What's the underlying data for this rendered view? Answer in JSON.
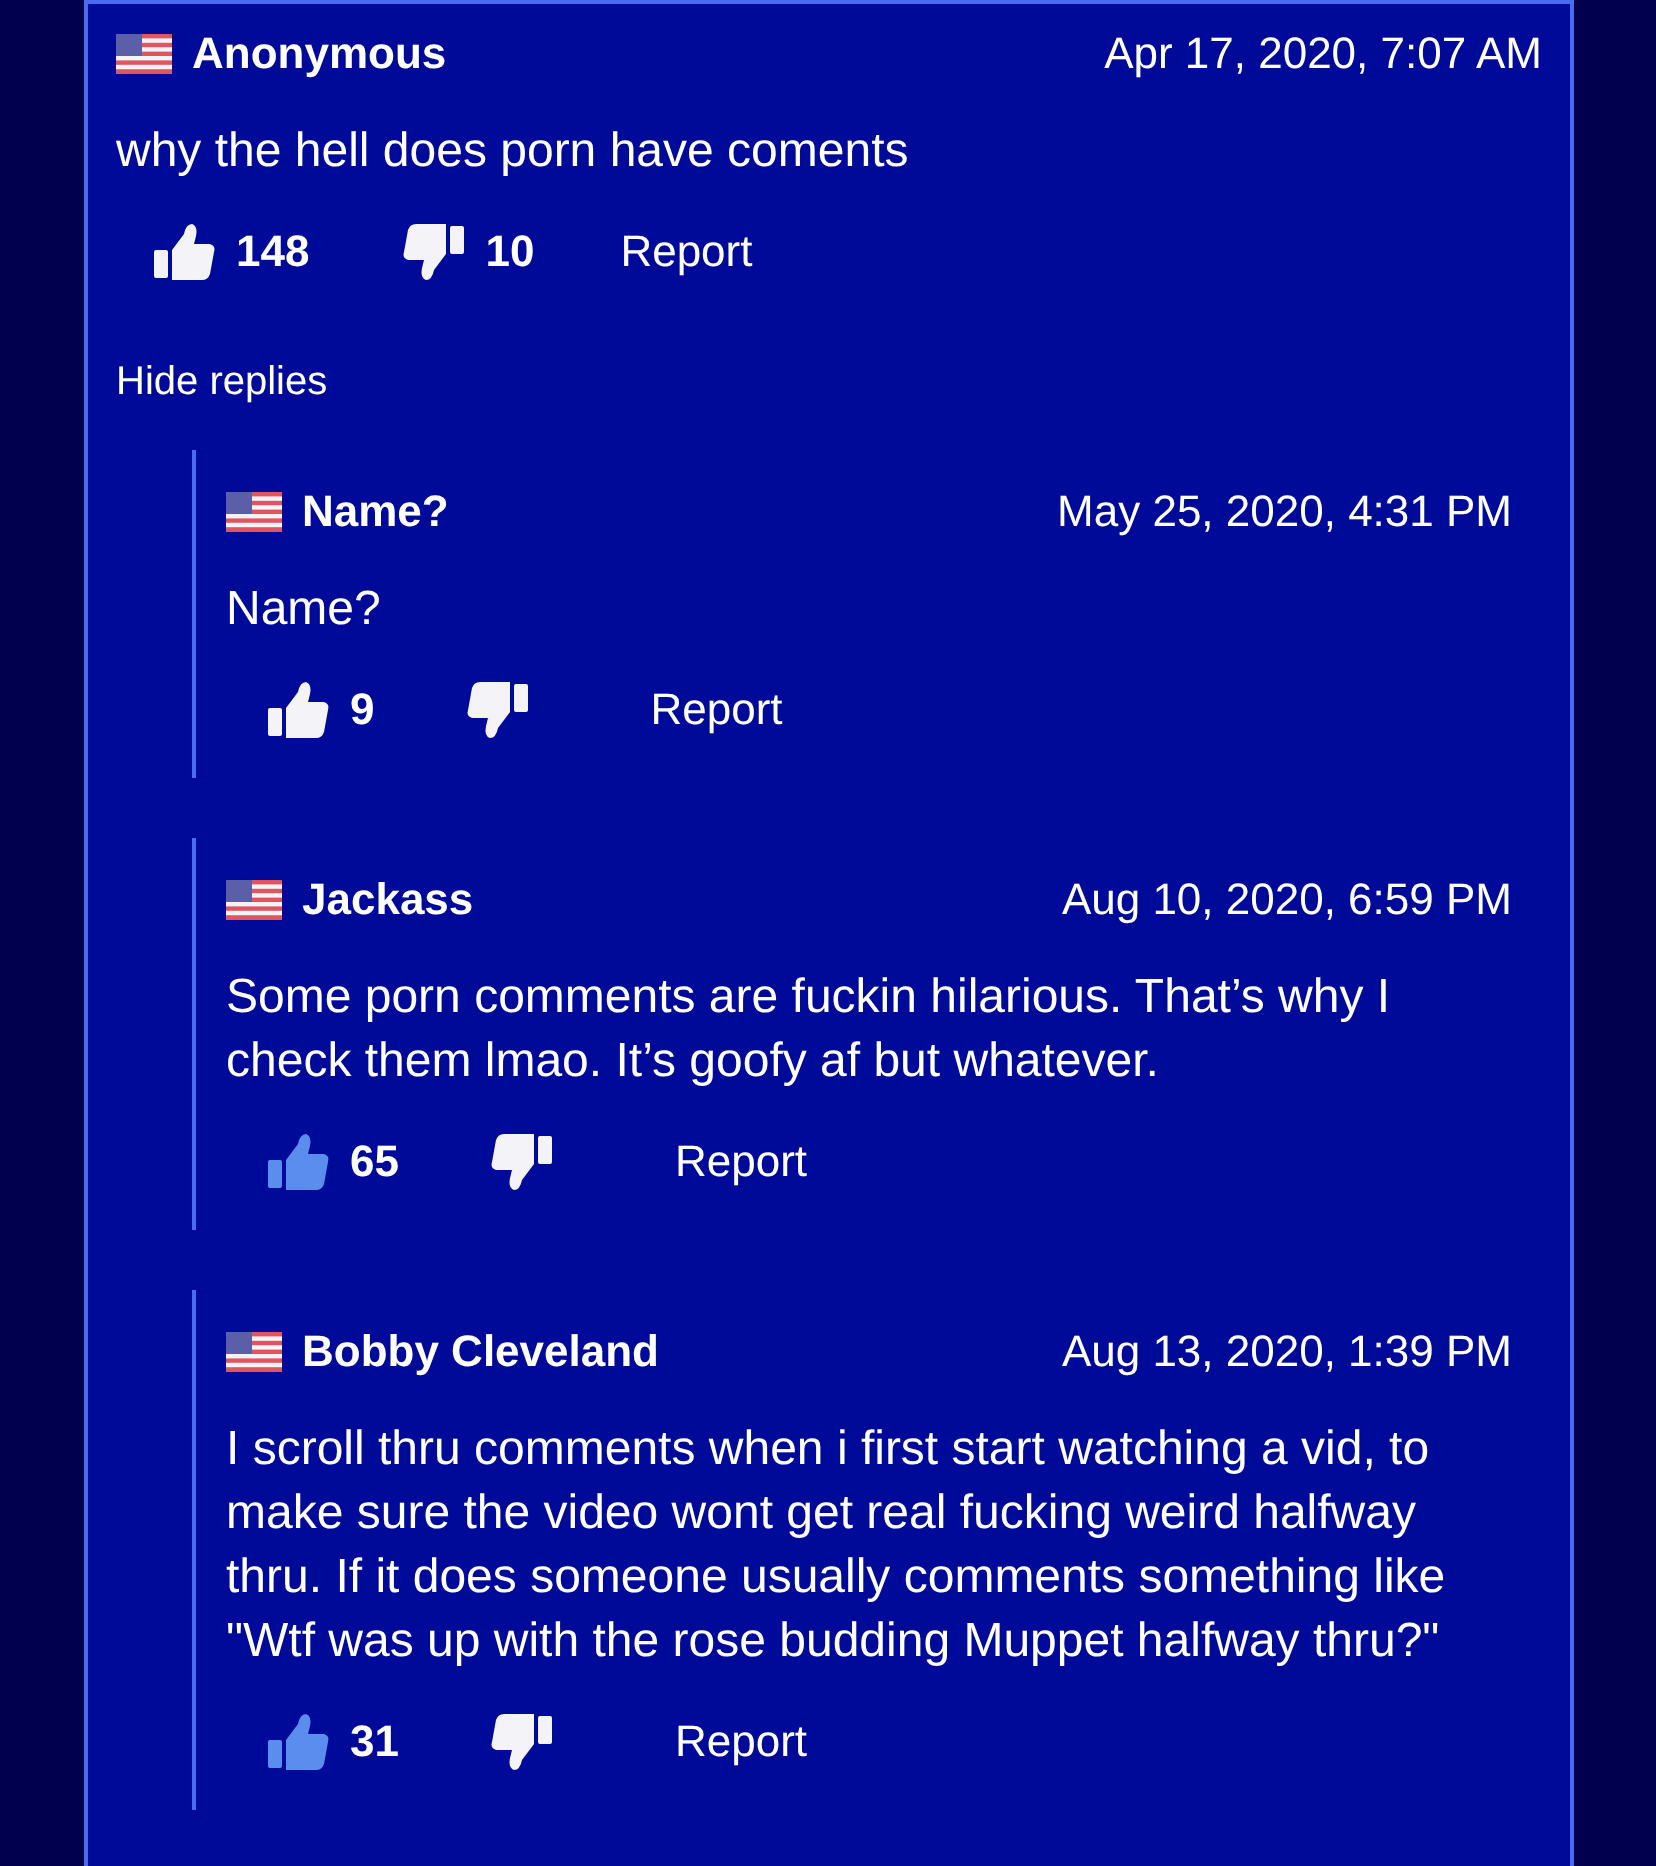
{
  "comments": [
    {
      "author": "Anonymous",
      "date": "Apr 17, 2020, 7:07 AM",
      "text": "why the hell does porn have coments",
      "likes": "148",
      "dislikes": "10",
      "liked": false,
      "report": "Report",
      "replies_toggle": "Hide replies",
      "replies": [
        {
          "author": "Name?",
          "date": "May 25, 2020, 4:31 PM",
          "text": "Name?",
          "likes": "9",
          "liked": false,
          "report": "Report"
        },
        {
          "author": "Jackass",
          "date": "Aug 10, 2020, 6:59 PM",
          "text": "Some porn comments are fuckin hilarious. That’s why I check them lmao. It’s goofy af but whatever.",
          "likes": "65",
          "liked": true,
          "report": "Report"
        },
        {
          "author": "Bobby Cleveland",
          "date": "Aug 13, 2020, 1:39 PM",
          "text": "I scroll thru comments when i first start watching a vid, to make sure the video wont get real fucking weird halfway thru. If it does someone usually comments something like \"Wtf was up with the rose budding Muppet halfway thru?\"",
          "likes": "31",
          "liked": true,
          "report": "Report"
        }
      ]
    }
  ]
}
